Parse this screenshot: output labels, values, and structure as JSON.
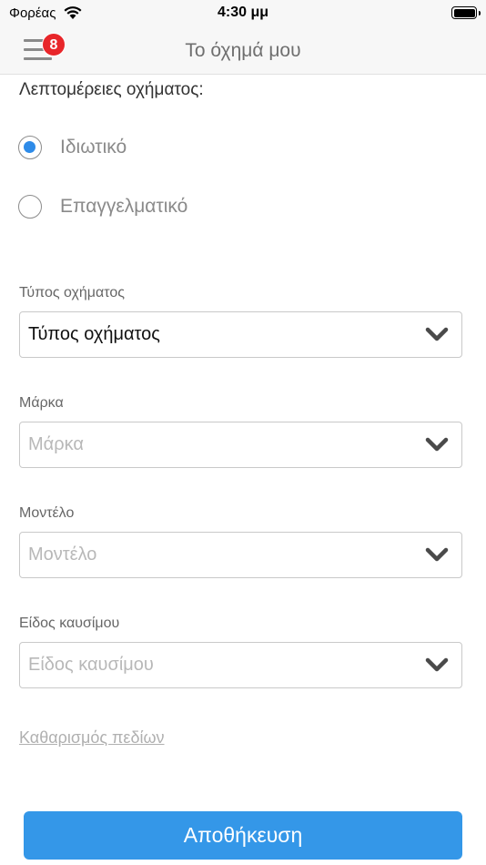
{
  "status_bar": {
    "carrier": "Φορέας",
    "time": "4:30 μμ"
  },
  "nav": {
    "title": "Το όχημά μου",
    "menu_badge": "8",
    "menu_icon": "hamburger-menu-icon"
  },
  "form": {
    "section_title": "Λεπτομέρειες οχήματος:",
    "vehicle_use": {
      "options": [
        {
          "label": "Ιδιωτικό",
          "selected": true
        },
        {
          "label": "Επαγγελματικό",
          "selected": false
        }
      ]
    },
    "fields": [
      {
        "label": "Τύπος οχήματος",
        "value": "Τύπος οχήματος",
        "filled": true
      },
      {
        "label": "Μάρκα",
        "value": "Μάρκα",
        "filled": false
      },
      {
        "label": "Μοντέλο",
        "value": "Μοντέλο",
        "filled": false
      },
      {
        "label": "Είδος καυσίμου",
        "value": "Είδος καυσίμου",
        "filled": false
      }
    ],
    "clear_link": "Καθαρισμός πεδίων",
    "save_button": "Αποθήκευση"
  },
  "colors": {
    "accent": "#3497e8",
    "badge": "#e8262a",
    "radio_selected": "#2e8be8"
  }
}
